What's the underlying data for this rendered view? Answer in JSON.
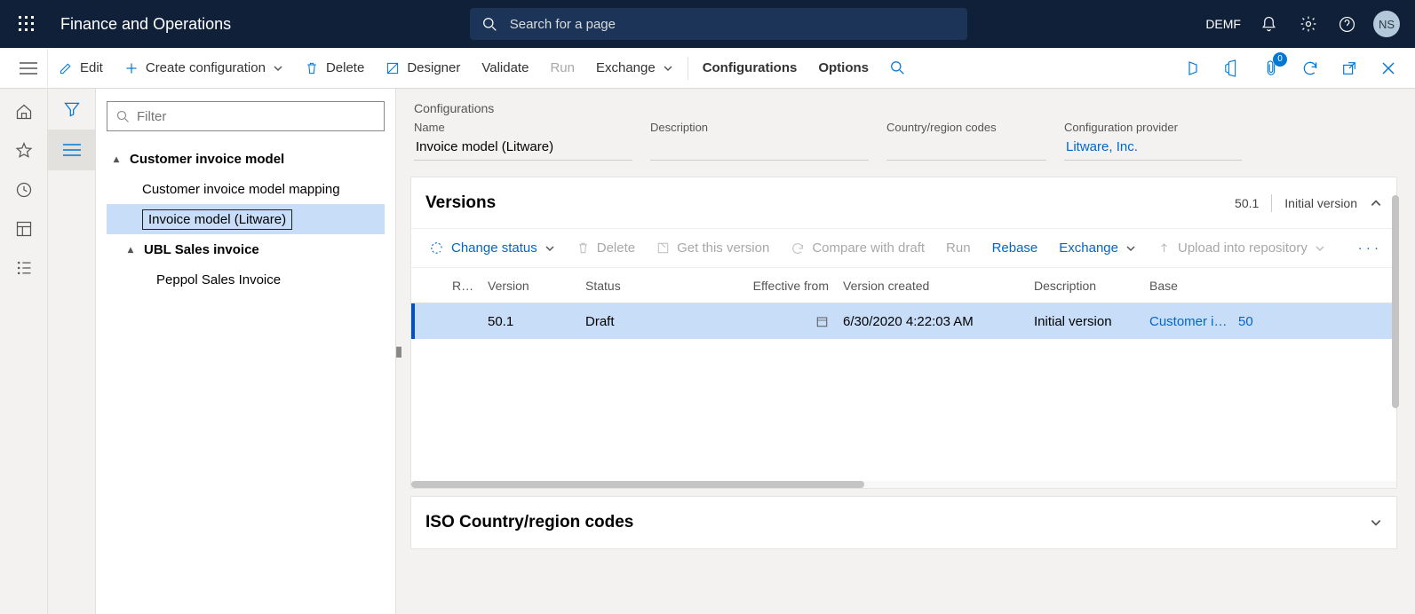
{
  "topbar": {
    "app_title": "Finance and Operations",
    "search_placeholder": "Search for a page",
    "company": "DEMF",
    "avatar_initials": "NS",
    "attach_badge": "0"
  },
  "actionbar": {
    "edit": "Edit",
    "create": "Create configuration",
    "delete": "Delete",
    "designer": "Designer",
    "validate": "Validate",
    "run": "Run",
    "exchange": "Exchange",
    "configurations": "Configurations",
    "options": "Options"
  },
  "tree": {
    "filter_placeholder": "Filter",
    "items": [
      {
        "label": "Customer invoice model",
        "level": "level0",
        "caret": "▲"
      },
      {
        "label": "Customer invoice model mapping",
        "level": "level1"
      },
      {
        "label": "Invoice model (Litware)",
        "level": "level1",
        "selected": true
      },
      {
        "label": "UBL Sales invoice",
        "level": "level1c",
        "caret": "▲"
      },
      {
        "label": "Peppol Sales Invoice",
        "level": "level2"
      }
    ]
  },
  "main": {
    "breadcrumb": "Configurations",
    "fields": {
      "name_label": "Name",
      "name_value": "Invoice model (Litware)",
      "desc_label": "Description",
      "desc_value": "",
      "country_label": "Country/region codes",
      "country_value": "",
      "provider_label": "Configuration provider",
      "provider_value": "Litware, Inc."
    },
    "versions": {
      "title": "Versions",
      "meta_version": "50.1",
      "meta_desc": "Initial version",
      "toolbar": {
        "change_status": "Change status",
        "delete": "Delete",
        "get_version": "Get this version",
        "compare": "Compare with draft",
        "run": "Run",
        "rebase": "Rebase",
        "exchange": "Exchange",
        "upload": "Upload into repository"
      },
      "columns": {
        "re": "Re...",
        "version": "Version",
        "status": "Status",
        "effective": "Effective from",
        "created": "Version created",
        "description": "Description",
        "base": "Base"
      },
      "rows": [
        {
          "version": "50.1",
          "status": "Draft",
          "effective": "",
          "created": "6/30/2020 4:22:03 AM",
          "description": "Initial version",
          "base": "Customer in...",
          "base_ver": "50"
        }
      ]
    },
    "iso": {
      "title": "ISO Country/region codes"
    }
  }
}
